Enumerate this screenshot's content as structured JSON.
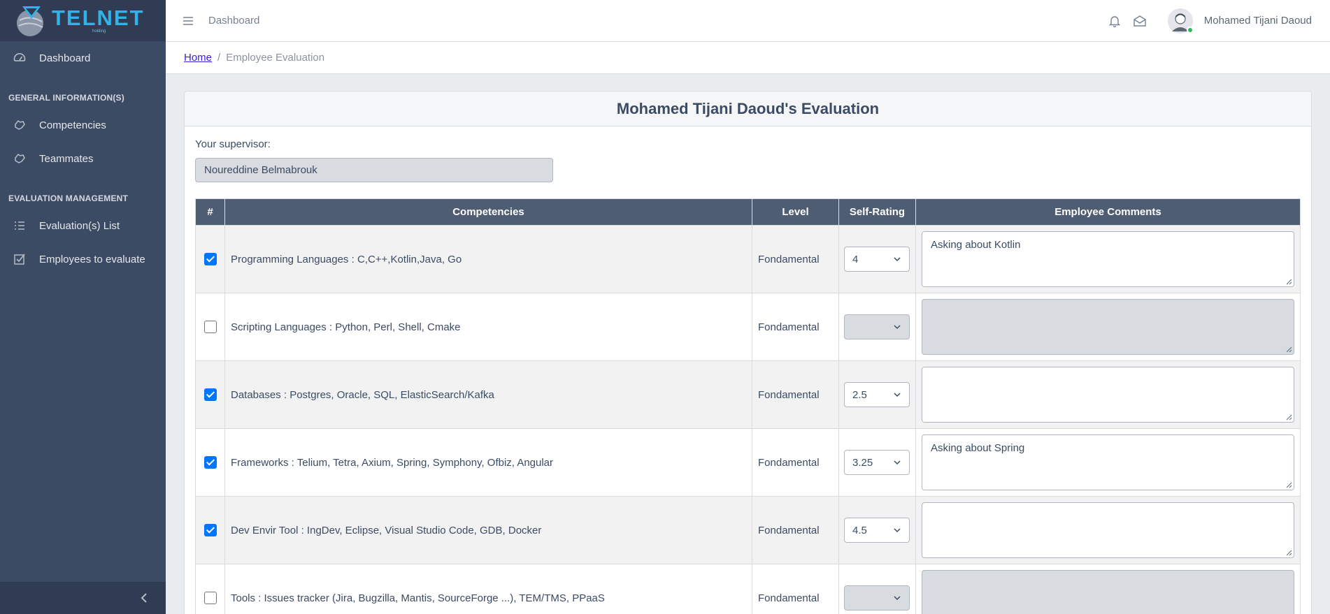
{
  "brand": {
    "name": "TELNET",
    "sub": "holding"
  },
  "sidebar": {
    "dashboard": "Dashboard",
    "section1": "GENERAL INFORMATION(S)",
    "competencies": "Competencies",
    "teammates": "Teammates",
    "section2": "EVALUATION MANAGEMENT",
    "evaluation_list": "Evaluation(s) List",
    "employees_to_evaluate": "Employees to evaluate"
  },
  "header": {
    "nav_link": "Dashboard",
    "user_name": "Mohamed Tijani Daoud"
  },
  "breadcrumb": {
    "home": "Home",
    "separator": "/",
    "current": "Employee Evaluation"
  },
  "card": {
    "title": "Mohamed Tijani Daoud's Evaluation",
    "supervisor_label": "Your supervisor:",
    "supervisor_value": "Noureddine Belmabrouk"
  },
  "table": {
    "headers": [
      "#",
      "Competencies",
      "Level",
      "Self-Rating",
      "Employee Comments"
    ],
    "rows": [
      {
        "checked": true,
        "competency": "Programming Languages : C,C++,Kotlin,Java, Go",
        "level": "Fondamental",
        "rating": "4",
        "comment": "Asking about Kotlin"
      },
      {
        "checked": false,
        "competency": "Scripting Languages : Python, Perl, Shell, Cmake",
        "level": "Fondamental",
        "rating": "",
        "comment": ""
      },
      {
        "checked": true,
        "competency": "Databases : Postgres, Oracle, SQL, ElasticSearch/Kafka",
        "level": "Fondamental",
        "rating": "2.5",
        "comment": ""
      },
      {
        "checked": true,
        "competency": "Frameworks : Telium, Tetra, Axium, Spring, Symphony, Ofbiz, Angular",
        "level": "Fondamental",
        "rating": "3.25",
        "comment": "Asking about Spring"
      },
      {
        "checked": true,
        "competency": "Dev Envir Tool : IngDev, Eclipse, Visual Studio Code, GDB, Docker",
        "level": "Fondamental",
        "rating": "4.5",
        "comment": ""
      },
      {
        "checked": false,
        "competency": "Tools : Issues tracker (Jira, Bugzilla, Mantis, SourceForge ...), TEM/TMS, PPaaS",
        "level": "Fondamental",
        "rating": "",
        "comment": ""
      }
    ]
  },
  "colors": {
    "sidebar": "#3c4b64",
    "sidebar_dark": "#303c54",
    "table_header": "#4f5d73",
    "brand": "#2fb3e8",
    "checkbox": "#0075ff"
  }
}
